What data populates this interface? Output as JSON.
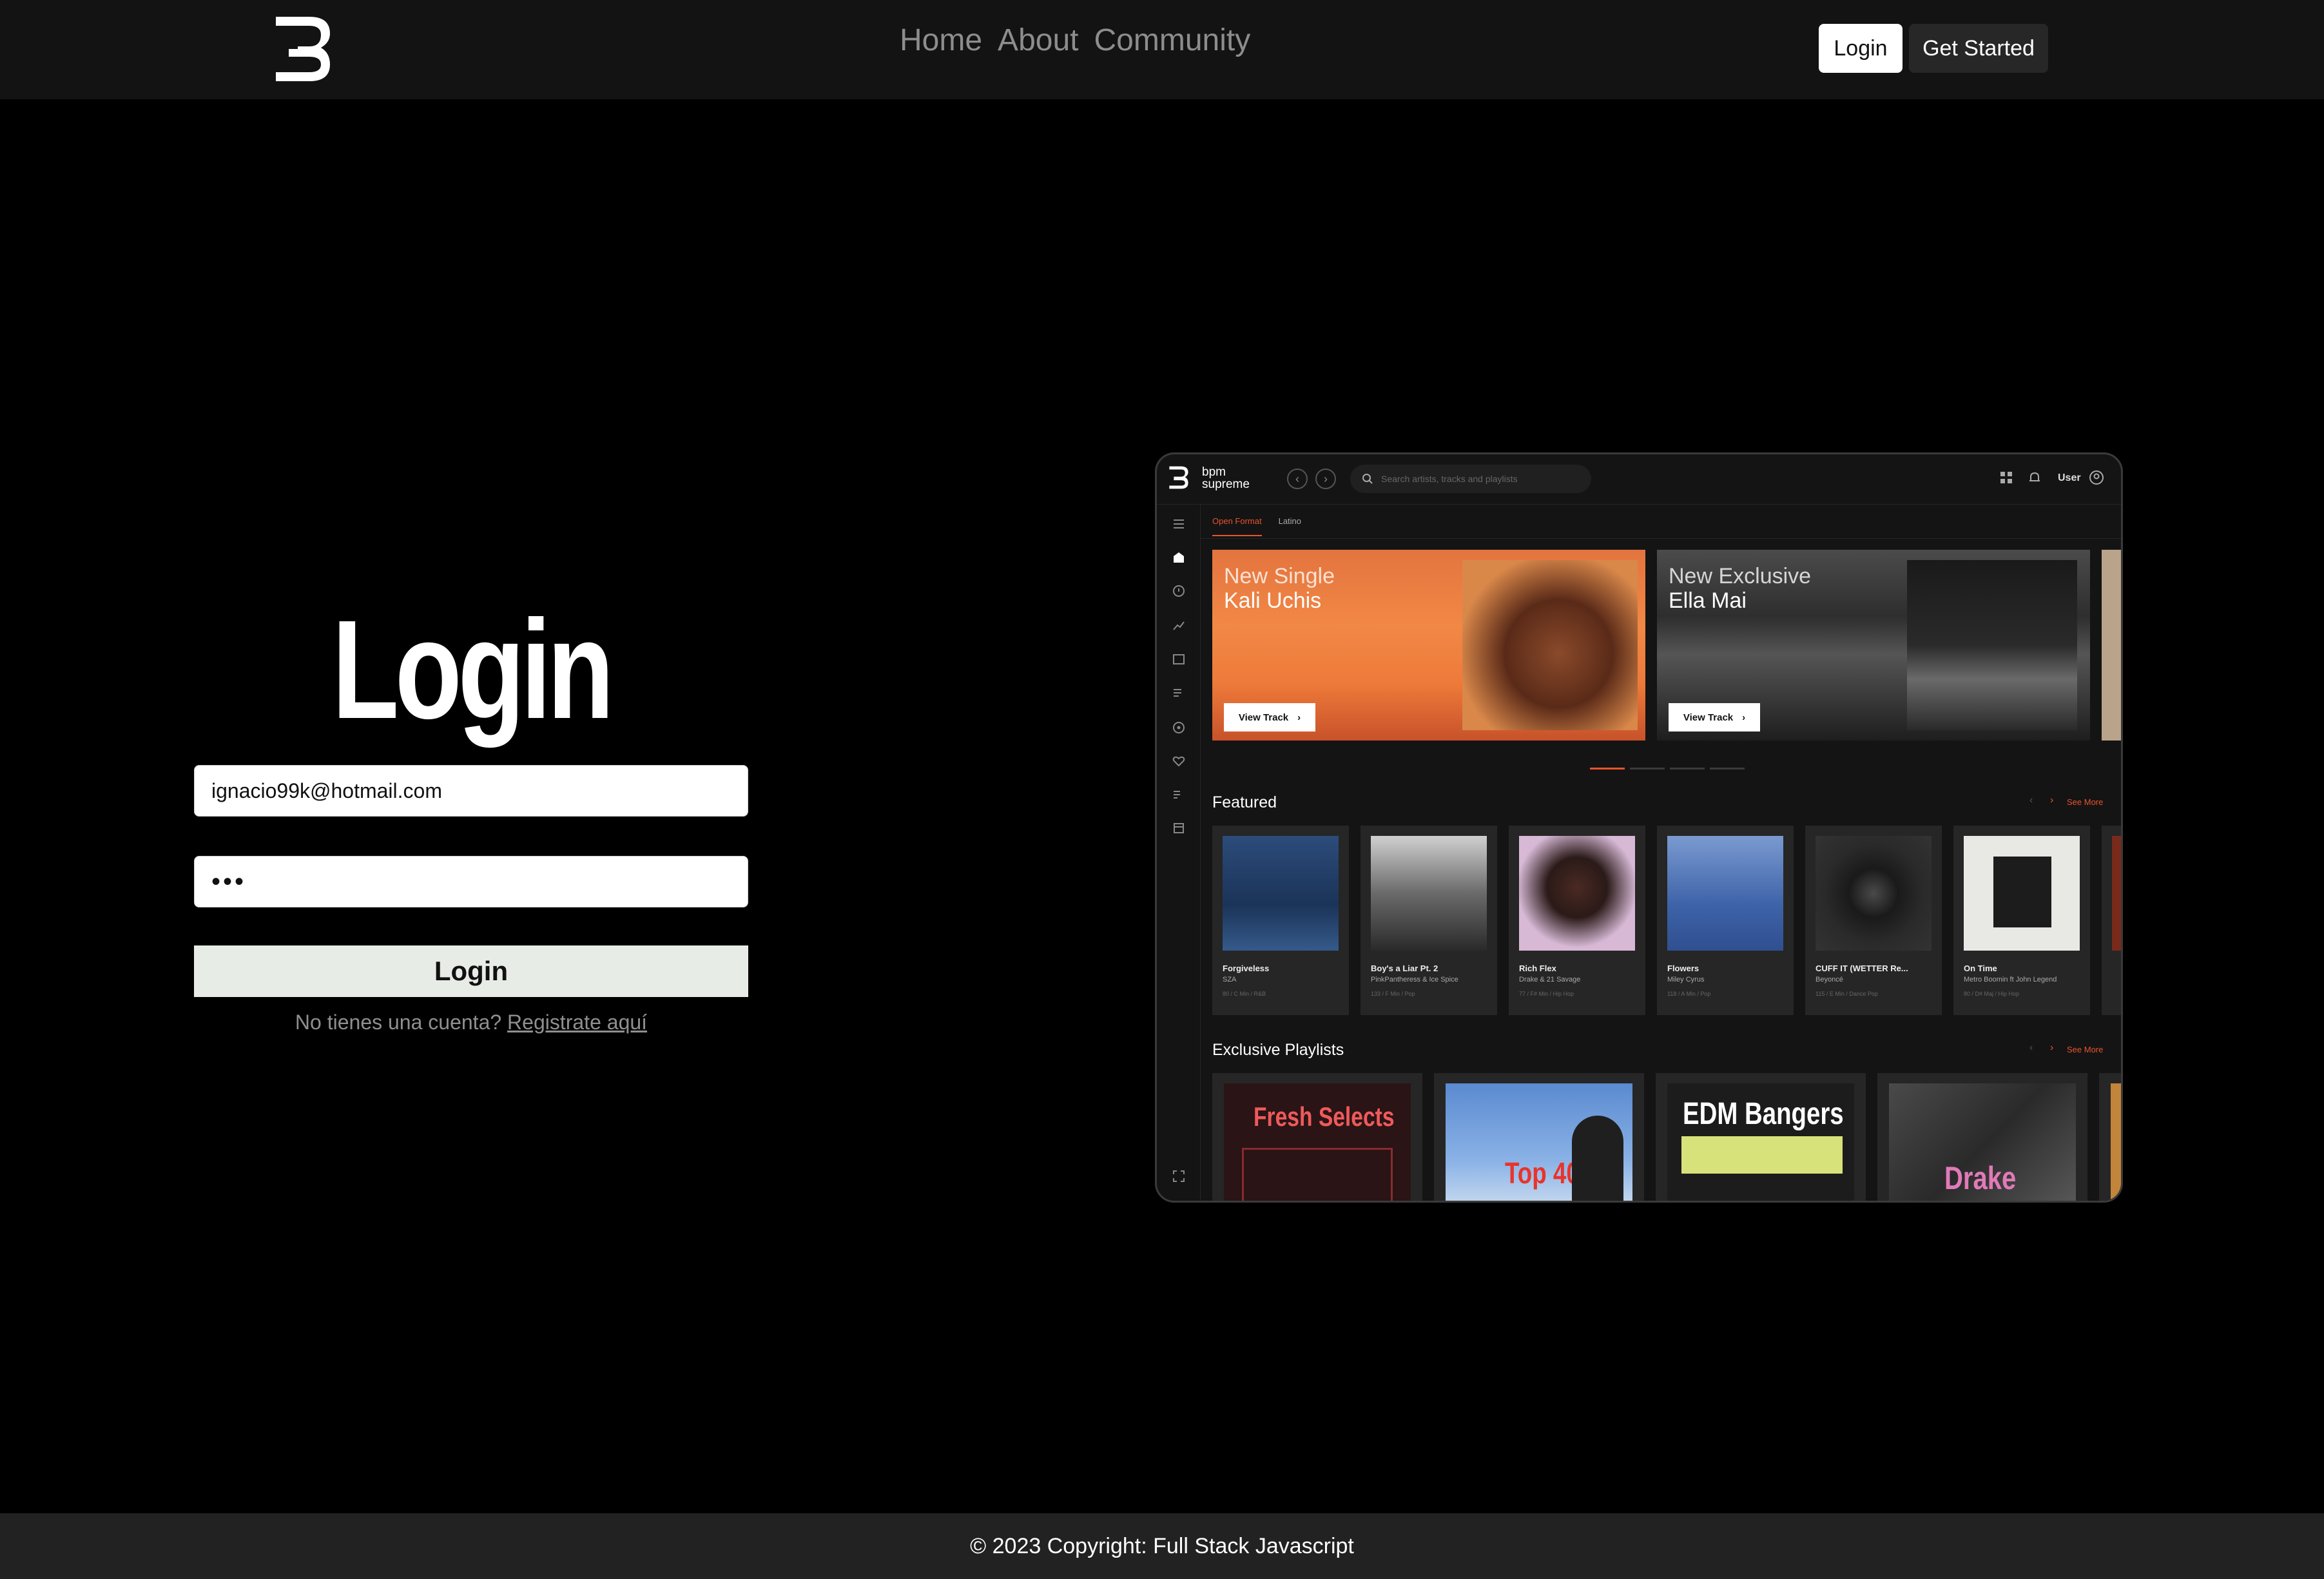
{
  "nav": {
    "links": [
      "Home",
      "About",
      "Community"
    ],
    "login_label": "Login",
    "get_started_label": "Get Started"
  },
  "login": {
    "title": "Login",
    "email_value": "ignacio99k@hotmail.com",
    "password_value": "•••",
    "submit_label": "Login",
    "register_prompt": "No tienes una cuenta?",
    "register_link": "Registrate aquí"
  },
  "preview": {
    "brand_line1": "bpm",
    "brand_line2": "supreme",
    "search_placeholder": "Search artists, tracks and playlists",
    "user_label": "User",
    "tabs": [
      "Open Format",
      "Latino"
    ],
    "banners": [
      {
        "label": "New Single",
        "artist": "Kali Uchis",
        "button": "View Track"
      },
      {
        "label": "New Exclusive",
        "artist": "Ella Mai",
        "button": "View Track"
      }
    ],
    "featured_title": "Featured",
    "see_more": "See More",
    "featured": [
      {
        "title": "Forgiveless",
        "artist": "SZA",
        "meta": "80 / C Min / R&B"
      },
      {
        "title": "Boy's a Liar Pt. 2",
        "artist": "PinkPantheress & Ice Spice",
        "meta": "133 / F Min / Pop"
      },
      {
        "title": "Rich Flex",
        "artist": "Drake & 21 Savage",
        "meta": "77 / F# Min / Hip Hop"
      },
      {
        "title": "Flowers",
        "artist": "Miley Cyrus",
        "meta": "118 / A Min / Pop"
      },
      {
        "title": "CUFF IT (WETTER Re...",
        "artist": "Beyoncé",
        "meta": "115 / E Min / Dance Pop"
      },
      {
        "title": "On Time",
        "artist": "Metro Boomin ft John Legend",
        "meta": "80 / D# Maj / Hip Hop"
      }
    ],
    "playlists_title": "Exclusive Playlists",
    "playlists": [
      "Fresh Selects",
      "Top 40",
      "EDM Bangers",
      "Drake"
    ]
  },
  "footer": {
    "text": "© 2023 Copyright: Full Stack Javascript"
  }
}
